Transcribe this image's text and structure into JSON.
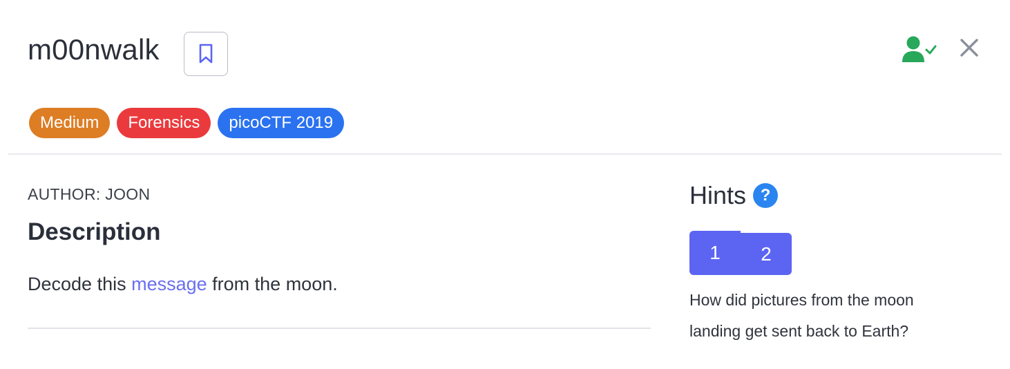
{
  "header": {
    "title": "m00nwalk"
  },
  "tags": {
    "difficulty": "Medium",
    "category": "Forensics",
    "event": "picoCTF 2019"
  },
  "main": {
    "author": "AUTHOR: JOON",
    "description_heading": "Description",
    "description_prefix": "Decode this ",
    "description_link": "message",
    "description_suffix": " from the moon."
  },
  "hints": {
    "heading": "Hints",
    "help_icon": "?",
    "tabs": [
      "1",
      "2"
    ],
    "text": "How did pictures from the moon landing get sent back to Earth?"
  },
  "icons": {
    "bookmark": "bookmark-icon",
    "solved": "user-check-icon",
    "close": "close-icon"
  },
  "colors": {
    "difficulty": "#dd7d24",
    "category": "#ea3a3d",
    "event": "#2a72ef",
    "link": "#6a6ff0",
    "hint_tab": "#5c65f2",
    "solved_icon": "#27a85a"
  }
}
